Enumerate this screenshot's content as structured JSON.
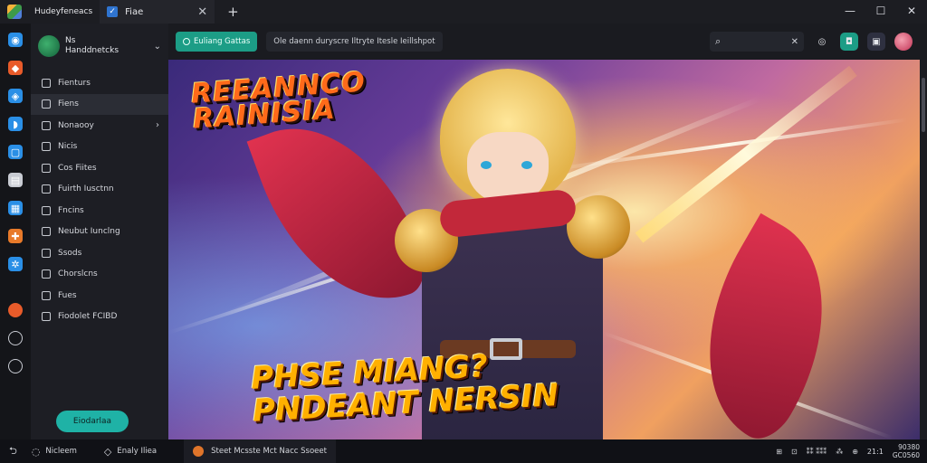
{
  "titlebar": {
    "app_name": "Hudeyfeneacs",
    "tab_label": "Fiae",
    "tab_icon": "checkmark-icon",
    "close_glyph": "✕",
    "new_tab_glyph": "+",
    "window_controls": [
      "—",
      "☐",
      "✕"
    ]
  },
  "rail": {
    "icons": [
      {
        "name": "globe-icon",
        "color": "#2a8fe6"
      },
      {
        "name": "cube-icon",
        "color": "#e85b2a"
      },
      {
        "name": "diamond-icon",
        "color": "#2a8fe6"
      },
      {
        "name": "shield-icon",
        "color": "#2a8fe6"
      },
      {
        "name": "square-icon",
        "color": "#2a8fe6"
      },
      {
        "name": "layers-icon",
        "color": "#c9ccd3"
      },
      {
        "name": "document-icon",
        "color": "#2a8fe6"
      },
      {
        "name": "puzzle-icon",
        "color": "#e87a2a"
      },
      {
        "name": "gear-icon",
        "color": "#2a8fe6"
      }
    ],
    "bottom_icons": [
      {
        "name": "fire-icon",
        "color": "#e85b2a"
      },
      {
        "name": "settings-icon",
        "color": "#c9ccd3"
      },
      {
        "name": "chat-icon",
        "color": "#c9ccd3"
      }
    ]
  },
  "sidebar": {
    "profile_line1": "Ns",
    "profile_line2": "Handdnetcks",
    "items": [
      {
        "label": "Fienturs",
        "icon": "star-icon"
      },
      {
        "label": "Fiens",
        "icon": "box-icon",
        "selected": true
      },
      {
        "label": "Nonaooy",
        "icon": "pencil-icon",
        "arrow": true
      },
      {
        "label": "Nicis",
        "icon": "tag-icon"
      },
      {
        "label": "Cos Fiites",
        "icon": "gear-icon"
      },
      {
        "label": "Fuirth Iusctnn",
        "icon": "document-icon"
      },
      {
        "label": "Fncins",
        "icon": "document-icon"
      },
      {
        "label": "Neubut Iunclng",
        "icon": "grid-icon"
      },
      {
        "label": "Ssods",
        "icon": "calendar-icon"
      },
      {
        "label": "Chorslcns",
        "icon": "box-icon"
      },
      {
        "label": "Fues",
        "icon": "circle-icon"
      },
      {
        "label": "Fiodolet FCIBD",
        "icon": "monitor-icon"
      }
    ],
    "action_button": "Eiodarlaa"
  },
  "toolbar": {
    "primary_button": "Euliang Gattas",
    "breadcrumb": "Ole daenn duryscre Iltryte  Itesle  Ieillshpot",
    "search_placeholder": "",
    "search_clear": "✕",
    "accent": "#1c9d86"
  },
  "hero": {
    "logo_top": "REEANNCO\nRAINISIA",
    "logo_bottom": "PHSE MIANG?\nPNDEANT NERSIN"
  },
  "taskbar": {
    "start_label": "Nicleem",
    "item2_label": "Enaly Iliea",
    "active_label": "Steet  Mcsste  Mct  Nacc Ssoeet",
    "tray_items": [
      "⊞",
      "⊡",
      "⁑⁑ ⁑⁑⁑",
      "⁂",
      "⊕",
      "21:1"
    ],
    "clock_line1": "90380",
    "clock_line2": "GC0560"
  }
}
